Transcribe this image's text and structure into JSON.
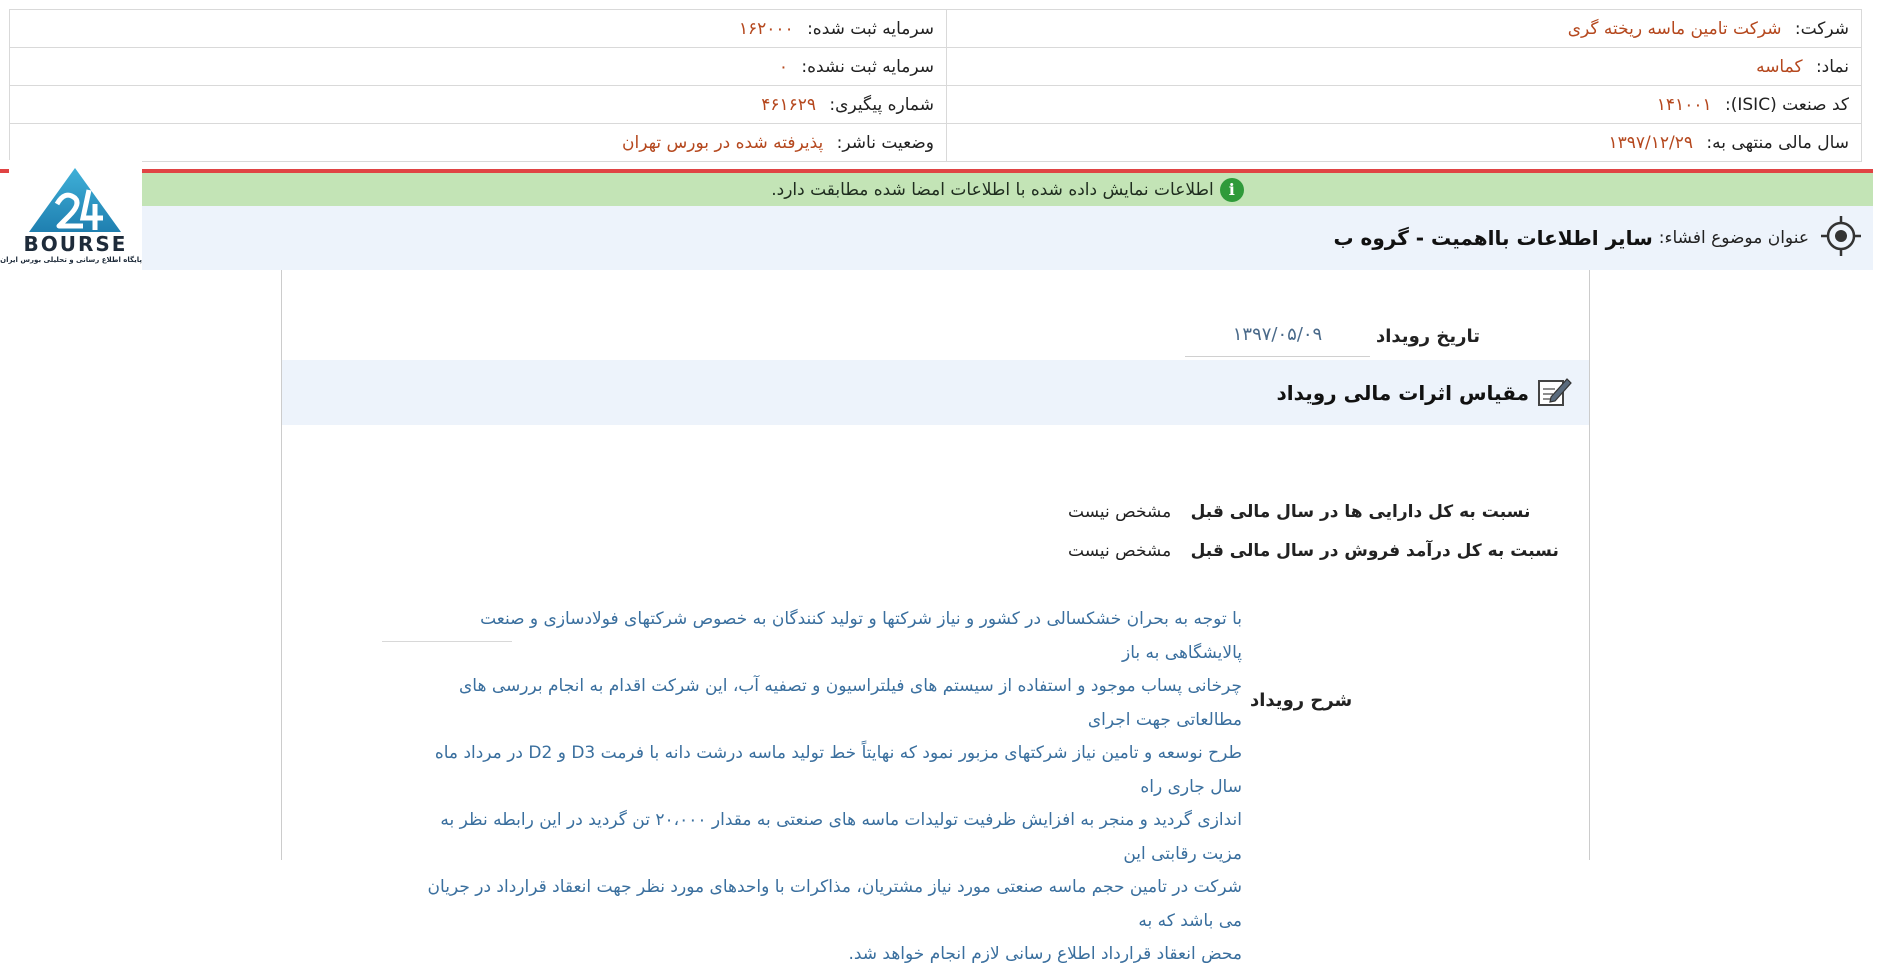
{
  "company_info": {
    "company_label": "شرکت:",
    "company_name": "شرکت تامین ماسه ریخته گری",
    "symbol_label": "نماد:",
    "symbol": "کماسه",
    "isic_label": "کد صنعت (ISIC):",
    "isic": "۱۴۱۰۰۱",
    "fiscal_year_label": "سال مالی منتهی به:",
    "fiscal_year": "۱۳۹۷/۱۲/۲۹",
    "registered_capital_label": "سرمایه ثبت شده:",
    "registered_capital": "۱۶۲۰۰۰",
    "unregistered_capital_label": "سرمایه ثبت نشده:",
    "unregistered_capital": "۰",
    "tracking_label": "شماره پیگیری:",
    "tracking_number": "۴۶۱۶۲۹",
    "publisher_status_label": "وضعیت ناشر:",
    "publisher_status": "پذیرفته شده در بورس تهران"
  },
  "notice": {
    "text": "اطلاعات نمایش داده شده با اطلاعات امضا شده مطابقت دارد.",
    "icon": "info-icon",
    "icon_glyph": "i",
    "color": "#c3e4b6"
  },
  "subject": {
    "label": "عنوان موضوع افشاء:",
    "value": "سایر اطلاعات بااهمیت - گروه ب",
    "icon": "target-icon"
  },
  "logo": {
    "word": "BOURSE",
    "tagline": "پایگاه اطلاع رسانی و تحلیلی بورس ایران"
  },
  "event": {
    "date_label": "تاریخ رویداد",
    "date_value": "۱۳۹۷/۰۵/۰۹",
    "impact_title": "مقیاس اثرات مالی رویداد",
    "impact_icon": "edit-note-icon",
    "ratio_assets_label": "نسبت به کل دارایی ها در سال مالی قبل",
    "ratio_assets_value": "مشخص نیست",
    "ratio_sales_label": "نسبت به کل درآمد فروش در سال مالی قبل",
    "ratio_sales_value": "مشخص نیست",
    "description_label": "شرح رویداد",
    "description_lines": [
      "با توجه به بحران خشکسالی در کشور و نیاز شرکتها و تولید کنندگان به خصوص شرکتهای فولادسازی و صنعت پالایشگاهی به باز",
      "چرخانی پساب موجود و استفاده از سیستم های فیلتراسیون و تصفیه آب، این شرکت اقدام به انجام بررسی های مطالعاتی جهت اجرای",
      "طرح نوسعه و تامین نیاز شرکتهای مزبور نمود که نهایتاً خط تولید ماسه درشت دانه با فرمت D3 و D2 در مرداد ماه سال جاری راه",
      "اندازی گردید و منجر به افزایش ظرفیت تولیدات ماسه های صنعتی به مقدار ۲۰،۰۰۰ تن گردید در این رابطه نظر به مزیت رقابتی این",
      "شرکت در تامین حجم ماسه صنعتی مورد نیاز مشتریان، مذاکرات با واحدهای مورد نظر جهت انعقاد قرارداد در جریان می باشد که به",
      "محض انعقاد قرارداد اطلاع رسانی لازم انجام خواهد شد."
    ]
  },
  "colors": {
    "value_text": "#b5481e",
    "description_text": "#3a6f9e",
    "accent_red": "#e04444",
    "panel_blue": "#edf3fb"
  }
}
